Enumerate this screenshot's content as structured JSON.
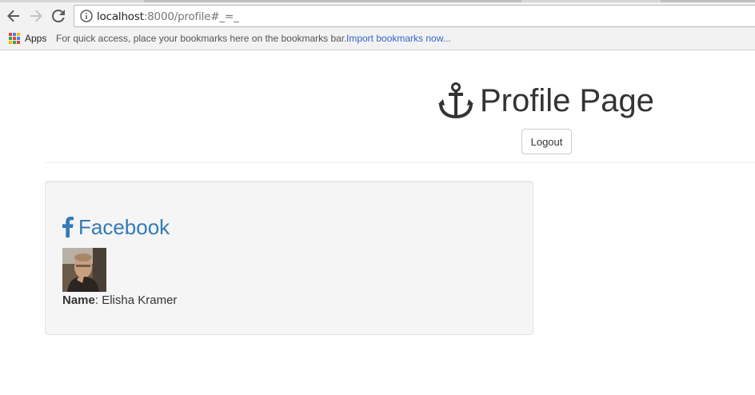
{
  "browser": {
    "url_host": "localhost",
    "url_path": ":8000/profile#_=_",
    "apps_label": "Apps",
    "bookmarks_hint": "For quick access, place your bookmarks here on the bookmarks bar.",
    "import_link": "Import bookmarks now...",
    "icons": [
      "back-arrow-icon",
      "forward-arrow-icon",
      "reload-icon",
      "info-icon",
      "apps-grid-icon"
    ]
  },
  "header": {
    "title": "Profile Page",
    "icon": "anchor-icon",
    "logout_label": "Logout"
  },
  "facebook_panel": {
    "heading": "Facebook",
    "icon": "facebook-icon",
    "name_label": "Name",
    "name_separator": ": ",
    "name_value": "Elisha Kramer"
  },
  "colors": {
    "link_blue": "#337ab7",
    "well_bg": "#f5f5f5",
    "bookmark_link": "#3366cc"
  }
}
